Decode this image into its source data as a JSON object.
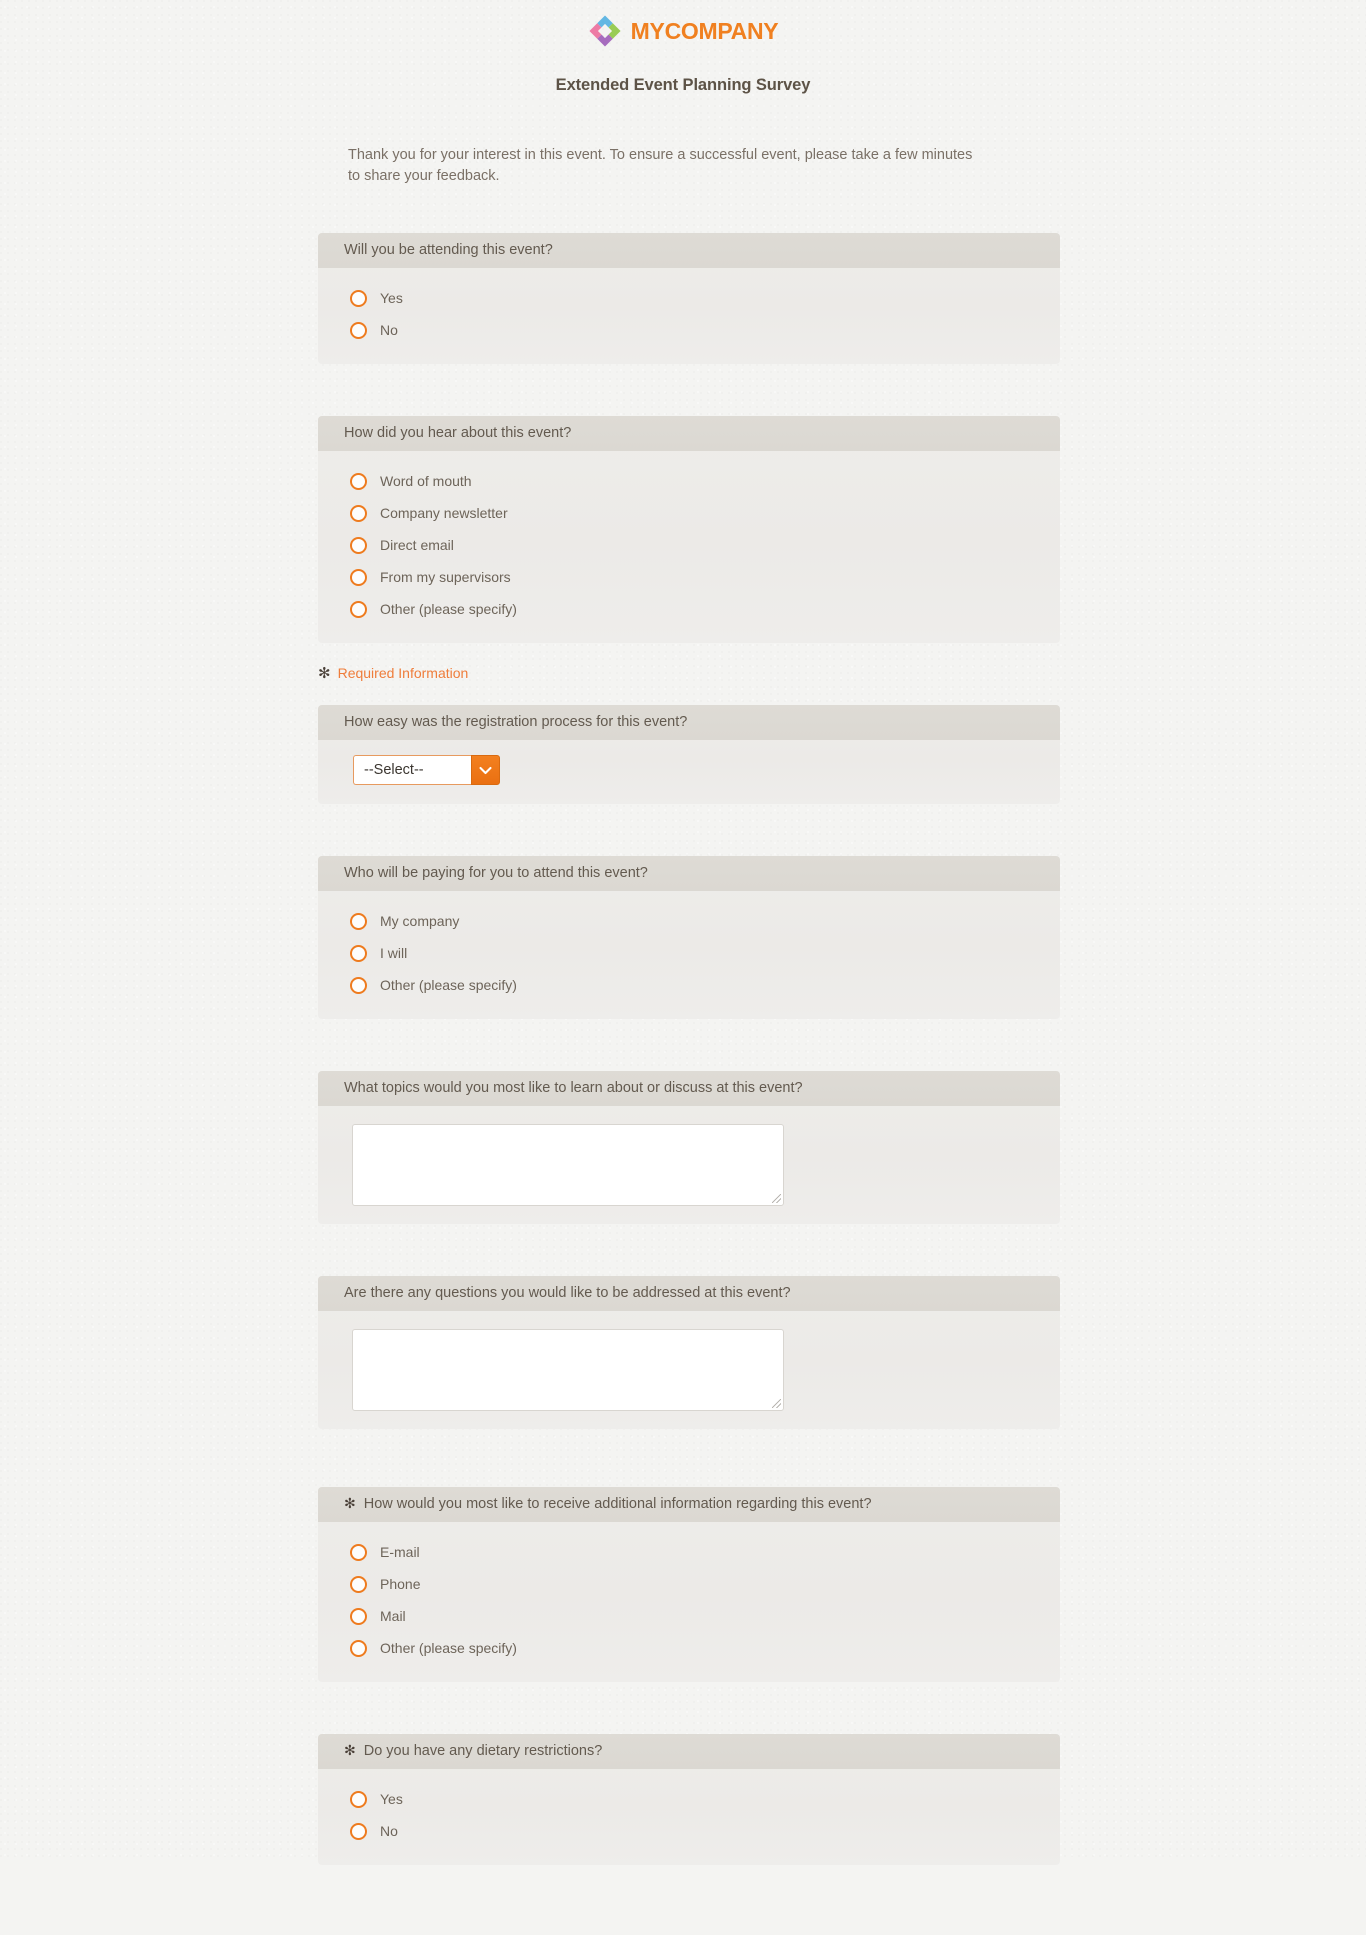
{
  "brand": {
    "logo_icon": "diamond-pinwheel-logo",
    "name_part1": "MY",
    "name_part2": "COMPANY",
    "logo_colors": [
      "#4eaee0",
      "#8cc63f",
      "#9b59b6",
      "#ec6a9a"
    ],
    "accent_color": "#f08020"
  },
  "form": {
    "title": "Extended Event Planning Survey",
    "intro": "Thank you for your interest in this event. To ensure a successful event, please take a few minutes to share your feedback.",
    "required_note": "Required Information",
    "required_marker": "✻"
  },
  "questions": [
    {
      "id": "attending",
      "label": "Will you be attending this event?",
      "required": false,
      "type": "radio",
      "options": [
        "Yes",
        "No"
      ]
    },
    {
      "id": "how-heard",
      "label": "How did you hear about this event?",
      "required": false,
      "type": "radio",
      "options": [
        "Word of mouth",
        "Company newsletter",
        "Direct email",
        "From my supervisors",
        "Other (please specify)"
      ]
    },
    {
      "id": "registration-ease",
      "label": "How easy was the registration process for this event?",
      "required": false,
      "type": "select",
      "selected": "--Select--"
    },
    {
      "id": "who-paying",
      "label": "Who will be paying for you to attend this event?",
      "required": false,
      "type": "radio",
      "options": [
        "My company",
        "I will",
        "Other (please specify)"
      ]
    },
    {
      "id": "topics",
      "label": "What topics would you most like to learn about or discuss at this event?",
      "required": false,
      "type": "textarea",
      "value": ""
    },
    {
      "id": "questions-addressed",
      "label": "Are there any questions you would like to be addressed at this event?",
      "required": false,
      "type": "textarea",
      "value": ""
    },
    {
      "id": "contact-method",
      "label": "How would you most like to receive additional information regarding this event?",
      "required": true,
      "type": "radio",
      "options": [
        "E-mail",
        "Phone",
        "Mail",
        "Other (please specify)"
      ]
    },
    {
      "id": "dietary",
      "label": "Do you have any dietary restrictions?",
      "required": true,
      "type": "radio",
      "options": [
        "Yes",
        "No"
      ]
    }
  ],
  "colors": {
    "page_background": "#f4f4f2",
    "panel_body": "#eceae7",
    "panel_header": "#dcd9d3",
    "radio_ring": "#ee7b1e",
    "select_button": "#f0801f",
    "text": "#6b6257",
    "required_text": "#ef7d3b"
  }
}
